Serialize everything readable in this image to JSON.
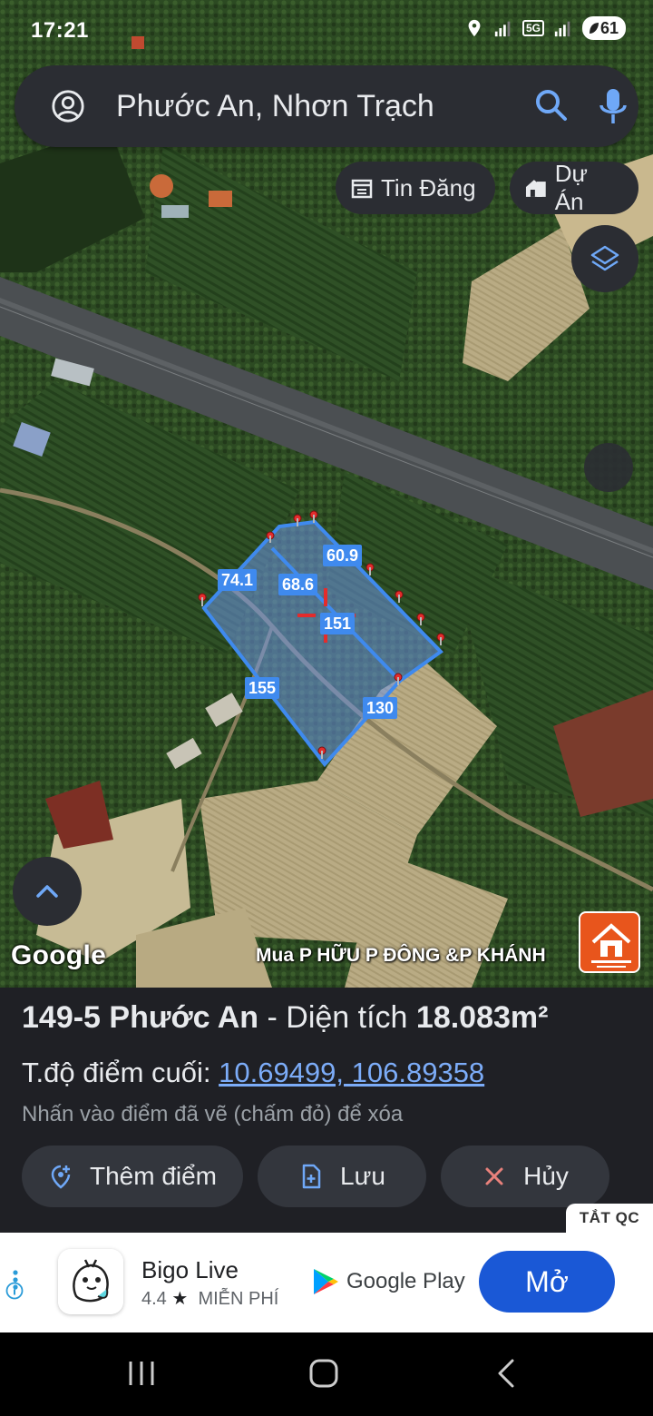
{
  "status_bar": {
    "time": "17:21",
    "network": "5G",
    "battery": "61"
  },
  "search": {
    "value": "Phước An, Nhơn Trạch",
    "placeholder": "Phước An, Nhơn Trạch"
  },
  "chips": {
    "listings": "Tin Đăng",
    "projects": "Dự Án"
  },
  "parcel": {
    "labels": [
      "74.1",
      "68.6",
      "60.9",
      "151",
      "155",
      "130"
    ]
  },
  "map": {
    "google_logo": "Google",
    "caption": "Mua P HỮU P ĐÔNG &P KHÁNH"
  },
  "panel": {
    "title_prefix": "149-5 Phước An",
    "title_sep": " - Diện tích ",
    "area_value": "18.083m²",
    "coord_label": "T.độ điểm cuối: ",
    "coord_value": "10.69499, 106.89358",
    "hint": "Nhấn vào điểm đã vẽ (chấm đỏ) để xóa",
    "add_point": "Thêm điểm",
    "save": "Lưu",
    "cancel": "Hủy"
  },
  "ad": {
    "close_label": "TẮT QC",
    "app_name": "Bigo Live",
    "rating": "4.4",
    "star": "★",
    "price": "MIỄN PHÍ",
    "store": "Google Play",
    "open": "Mở"
  },
  "colors": {
    "accent": "#3f8aee",
    "map_ui_bg": "#2b2d33",
    "panel_bg": "#1f2025",
    "link": "#7cacf8",
    "open_button": "#1a58d6"
  }
}
